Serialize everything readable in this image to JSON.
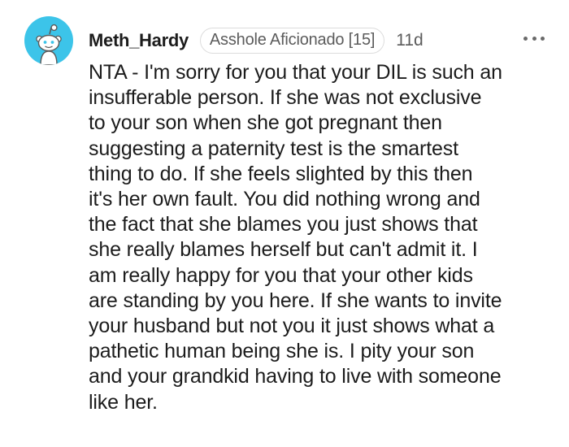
{
  "comment": {
    "avatar_icon": "reddit-snoo-avatar",
    "avatar_color": "#3cc4e9",
    "username": "Meth_Hardy",
    "flair": "Asshole Aficionado [15]",
    "time": "11d",
    "more_icon": "more-options-icon",
    "body_lines": [
      "NTA - I'm sorry for you that your DIL is such an",
      "insufferable person. If she was not exclusive",
      "to your son when she got pregnant then",
      "suggesting a paternity test is the smartest",
      "thing to do. If she feels slighted by this then",
      "it's her own fault. You did nothing wrong and",
      "the fact that she blames you just shows that",
      "she really blames herself but can't admit it. I",
      "am really happy for you that your other kids",
      "are standing by you here. If she wants to invite",
      "your husband but not you it just shows what a",
      "pathetic human being she is. I pity your son",
      "and your grandkid having to live with someone",
      "like her."
    ]
  }
}
